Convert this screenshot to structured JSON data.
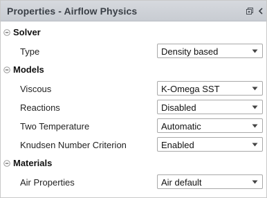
{
  "panel": {
    "title": "Properties - Airflow Physics"
  },
  "sections": {
    "solver": {
      "title": "Solver",
      "type": {
        "label": "Type",
        "value": "Density based"
      }
    },
    "models": {
      "title": "Models",
      "viscous": {
        "label": "Viscous",
        "value": "K-Omega SST"
      },
      "reactions": {
        "label": "Reactions",
        "value": "Disabled"
      },
      "two_temperature": {
        "label": "Two Temperature",
        "value": "Automatic"
      },
      "knudsen": {
        "label": "Knudsen Number Criterion",
        "value": "Enabled"
      }
    },
    "materials": {
      "title": "Materials",
      "air_properties": {
        "label": "Air Properties",
        "value": "Air default"
      }
    }
  },
  "icons": {
    "restore": "restore-window-icon",
    "collapse_panel": "chevron-left-icon",
    "section_toggle": "minus-collapse-icon",
    "dropdown": "triangle-down-icon"
  },
  "colors": {
    "titlebar": "#c8ccd2",
    "title_text": "#3a3f46",
    "border": "#a8a8a8"
  }
}
